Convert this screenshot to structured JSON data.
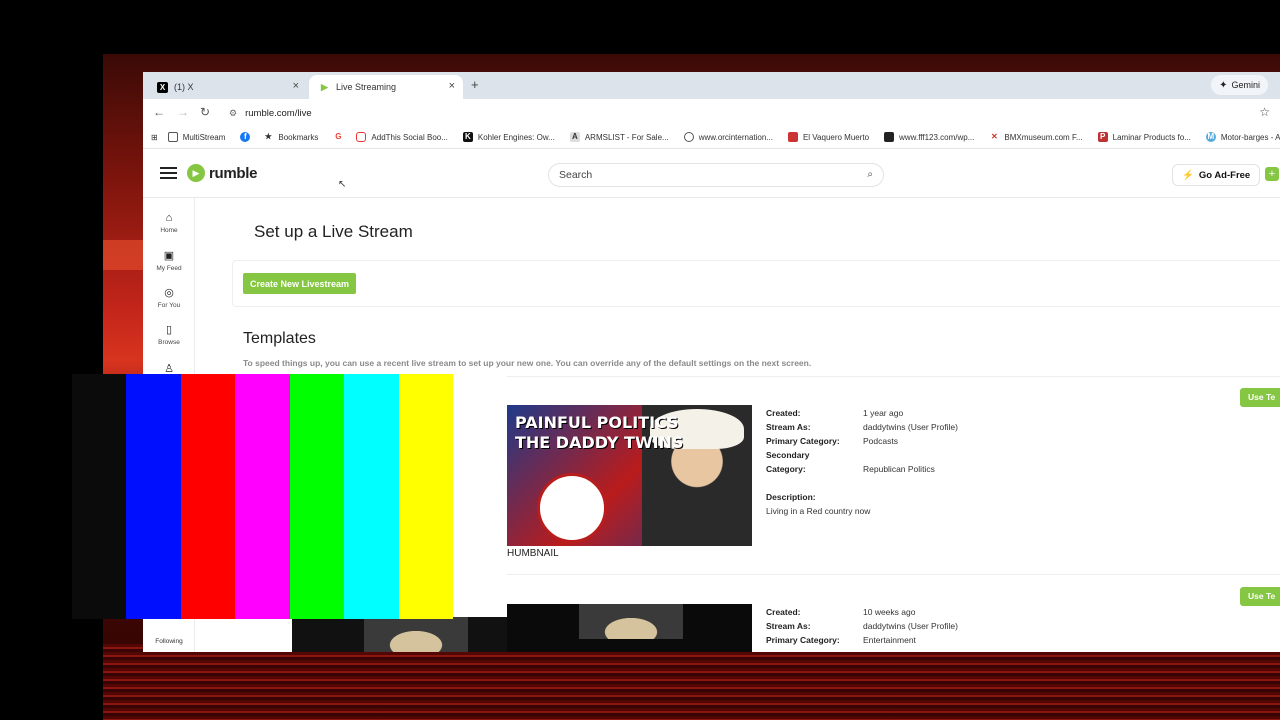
{
  "browser": {
    "tabs": [
      {
        "label": "(1) X",
        "active": false
      },
      {
        "label": "Live Streaming",
        "active": true
      }
    ],
    "new_tab": "+",
    "gemini_label": "Gemini",
    "url": "rumble.com/live",
    "bookmarks": [
      "MultiStream",
      "Bookmarks",
      "AddThis Social Boo...",
      "Kohler Engines: Ow...",
      "ARMSLIST - For Sale...",
      "www.orcinternation...",
      "El Vaquero Muerto",
      "www.fff123.com/wp...",
      "BMXmuseum.com F...",
      "Laminar Products fo...",
      "Motor-barges - ALL..."
    ]
  },
  "header": {
    "logo_text": "rumble",
    "search_placeholder": "Search",
    "ad_free_label": "Go Ad-Free"
  },
  "sidebar": {
    "items": [
      {
        "label": "Home",
        "icon": "home-icon"
      },
      {
        "label": "My Feed",
        "icon": "feed-icon"
      },
      {
        "label": "For You",
        "icon": "target-icon"
      },
      {
        "label": "Browse",
        "icon": "browse-icon"
      }
    ],
    "following_label": "Following"
  },
  "main": {
    "title": "Set up a Live Stream",
    "create_button": "Create New Livestream",
    "templates_heading": "Templates",
    "templates_desc": "To speed things up, you can use a recent live stream to set up your new one. You can override any of the default settings on the next screen.",
    "use_template_label": "Use Te",
    "thumbnail_label": "HUMBNAIL",
    "template1": {
      "thumb_title_lines": [
        "PAINFUL POLITICS",
        "THE DADDY TWINS"
      ],
      "created_key": "Created:",
      "created": "1 year ago",
      "stream_as_key": "Stream As:",
      "stream_as": "daddytwins (User Profile)",
      "primary_key": "Primary Category:",
      "primary": "Podcasts",
      "secondary_key": "Secondary",
      "category_key": "Category:",
      "secondary": "Republican Politics",
      "description_key": "Description:",
      "description": "Living in a Red country now"
    },
    "template2": {
      "created_key": "Created:",
      "created": "10 weeks ago",
      "stream_as_key": "Stream As:",
      "stream_as": "daddytwins (User Profile)",
      "primary_key": "Primary Category:",
      "primary": "Entertainment"
    }
  },
  "colors": {
    "accent": "#85c742",
    "color_bars": [
      "#0b0b0b",
      "#0010ff",
      "#ff0000",
      "#ff00ff",
      "#00ff00",
      "#00ffff",
      "#ffff00"
    ]
  }
}
